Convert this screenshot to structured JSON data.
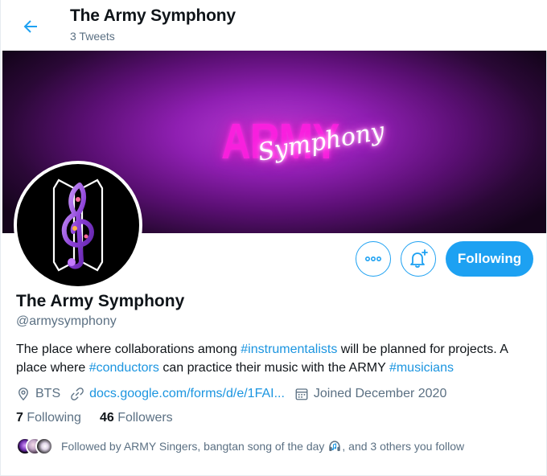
{
  "header": {
    "title": "The Army Symphony",
    "tweet_count": "3 Tweets"
  },
  "banner": {
    "text_main": "ARMY",
    "text_script": "Symphony"
  },
  "actions": {
    "following_label": "Following"
  },
  "profile": {
    "display_name": "The Army Symphony",
    "handle": "@armysymphony",
    "bio": {
      "part1": "The place where collaborations among ",
      "tag1": "#instrumentalists",
      "part2": " will be planned for projects. A place where ",
      "tag2": "#conductors",
      "part3": " can practice their music with the ARMY ",
      "tag3": "#musicians"
    },
    "location": "BTS",
    "website": "docs.google.com/forms/d/e/1FAI...",
    "joined": "Joined December 2020"
  },
  "counts": {
    "following_num": "7",
    "following_label": "Following",
    "followers_num": "46",
    "followers_label": "Followers"
  },
  "followed_by": {
    "text": "Followed by ARMY Singers, bangtan song of the day",
    "suffix": ", and 3 others you follow"
  },
  "colors": {
    "accent": "#1da1f2",
    "link": "#1b95e0",
    "muted": "#5b7083",
    "banner_glow": "#b83ed6"
  },
  "icons": {
    "back": "arrow-left-icon",
    "more": "more-dots-icon",
    "notify": "bell-plus-icon",
    "location": "location-pin-icon",
    "link": "link-icon",
    "calendar": "calendar-icon",
    "headphones": "headphones-emoji-icon"
  }
}
